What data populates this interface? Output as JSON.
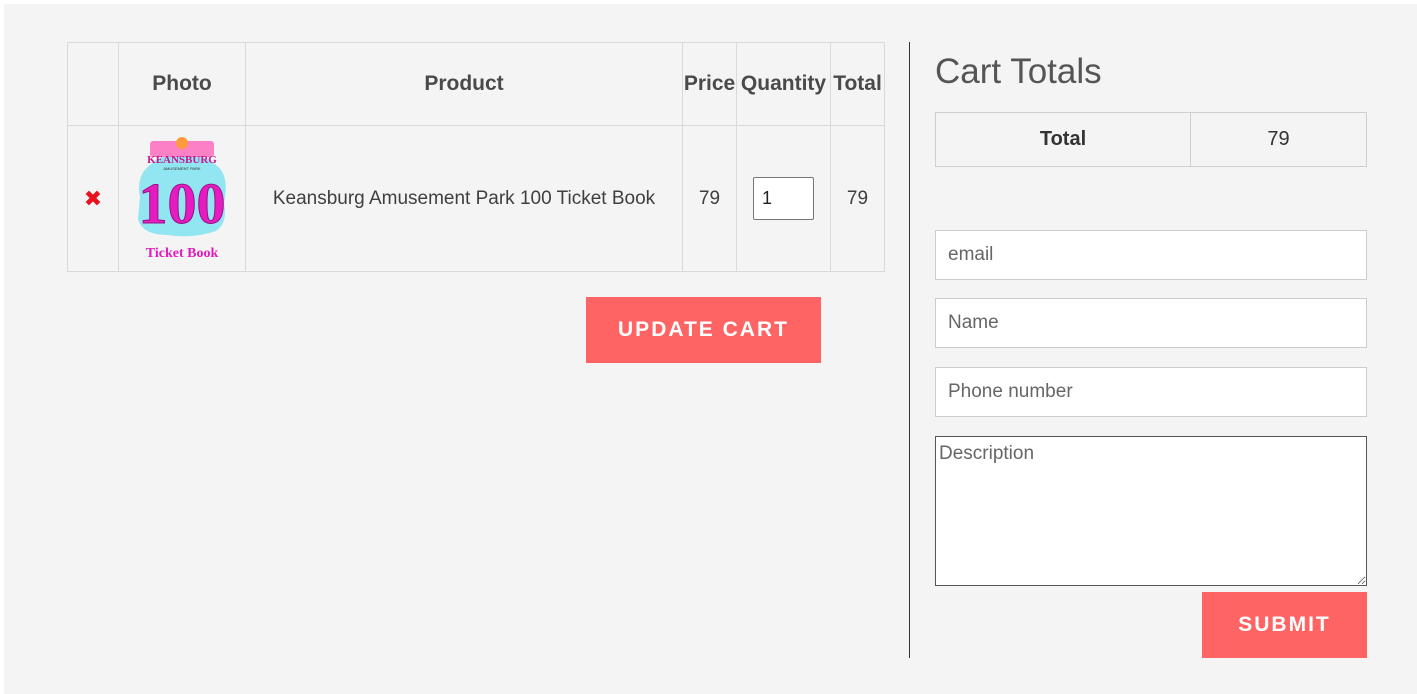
{
  "cart": {
    "headers": {
      "remove": "",
      "photo": "Photo",
      "product": "Product",
      "price": "Price",
      "quantity": "Quantity",
      "total": "Total"
    },
    "items": [
      {
        "remove_icon": "close-icon",
        "remove_color": "#e8111d",
        "remove_glyph": "✖",
        "photo_title": "KEANSBURG",
        "photo_subtitle": "AMUSEMENT PARK",
        "photo_number": "100",
        "photo_caption": "Ticket Book",
        "product": "Keansburg Amusement Park 100 Ticket Book",
        "price": "79",
        "quantity": "1",
        "total": "79"
      }
    ],
    "update_label": "UPDATE CART"
  },
  "totals": {
    "title": "Cart Totals",
    "label": "Total",
    "value": "79"
  },
  "form": {
    "email_placeholder": "email",
    "name_placeholder": "Name",
    "phone_placeholder": "Phone number",
    "description_placeholder": "Description",
    "submit_label": "SUBMIT"
  },
  "colors": {
    "accent": "#ff6464",
    "background": "#f4f4f4"
  }
}
